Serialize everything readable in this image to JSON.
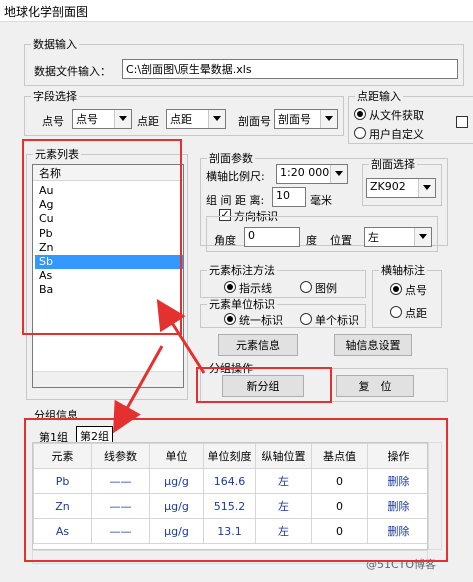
{
  "window": {
    "title": "地球化学剖面图"
  },
  "data_input": {
    "legend": "数据输入",
    "file_label": "数据文件输入：",
    "file_path": "C:\\剖面图\\原生晕数据.xls"
  },
  "field_select": {
    "legend": "字段选择",
    "point_label": "点号",
    "point_value": "点号",
    "distance_label": "点距",
    "distance_value": "点距",
    "section_label": "剖面号",
    "section_value": "剖面号"
  },
  "distance_input": {
    "legend": "点距输入",
    "opt_file": "从文件获取",
    "opt_custom": "用户自定义"
  },
  "element_list": {
    "legend": "元素列表",
    "header": "名称",
    "items": [
      "Au",
      "Ag",
      "Cu",
      "Pb",
      "Zn",
      "Sb",
      "As",
      "Ba"
    ],
    "selected": "Sb"
  },
  "section_params": {
    "legend": "剖面参数",
    "scale_label": "横轴比例尺:",
    "scale_value": "1:20 000",
    "spacing_label": "组 间 距 离:",
    "spacing_value": "10",
    "spacing_unit": "毫米",
    "direction_label": "方向标识",
    "angle_label": "角度",
    "angle_value": "0",
    "angle_unit": "度",
    "position_label": "位置",
    "position_value": "左"
  },
  "section_select": {
    "legend": "剖面选择",
    "value": "ZK902"
  },
  "label_method": {
    "legend": "元素标注方法",
    "opt_line": "指示线",
    "opt_legend": "图例"
  },
  "axis_label": {
    "legend": "横轴标注",
    "opt_point": "点号",
    "opt_distance": "点距"
  },
  "unit_label": {
    "legend": "元素单位标识",
    "opt_uniform": "统一标识",
    "opt_single": "单个标识"
  },
  "buttons": {
    "element_info": "元素信息",
    "axis_settings": "轴信息设置",
    "new_group": "新分组",
    "reset": "复　位"
  },
  "group_ops": {
    "legend": "分组操作"
  },
  "group_info": {
    "legend": "分组信息",
    "tabs": [
      "第1组",
      "第2组"
    ],
    "columns": [
      "元素",
      "线参数",
      "单位",
      "单位刻度",
      "纵轴位置",
      "基点值",
      "操作"
    ],
    "rows": [
      {
        "element": "Pb",
        "line": "——",
        "unit": "μg/g",
        "scale": "164.6",
        "position": "左",
        "base": "0",
        "action": "删除"
      },
      {
        "element": "Zn",
        "line": "——",
        "unit": "μg/g",
        "scale": "515.2",
        "position": "左",
        "base": "0",
        "action": "删除"
      },
      {
        "element": "As",
        "line": "——",
        "unit": "μg/g",
        "scale": "13.1",
        "position": "左",
        "base": "0",
        "action": "删除"
      }
    ]
  },
  "watermark": "@51CTO博客",
  "colors": {
    "highlight": "#e53030",
    "selection": "#3399ff"
  }
}
